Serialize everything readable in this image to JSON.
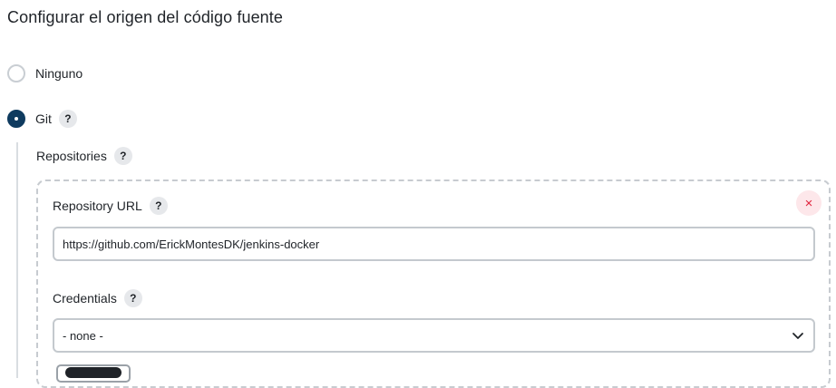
{
  "section": {
    "title": "Configurar el origen del código fuente"
  },
  "scm_options": {
    "none": {
      "label": "Ninguno",
      "selected": false
    },
    "git": {
      "label": "Git",
      "selected": true,
      "help": "?"
    }
  },
  "repositories": {
    "label": "Repositories",
    "help": "?",
    "delete_icon": "×",
    "url": {
      "label": "Repository URL",
      "help": "?",
      "value": "https://github.com/ErickMontesDK/jenkins-docker"
    },
    "credentials": {
      "label": "Credentials",
      "help": "?",
      "selected": "- none -"
    }
  },
  "colors": {
    "accent": "#0f3b5f",
    "danger": "#e0243d",
    "danger_bg": "#fde7ea"
  }
}
